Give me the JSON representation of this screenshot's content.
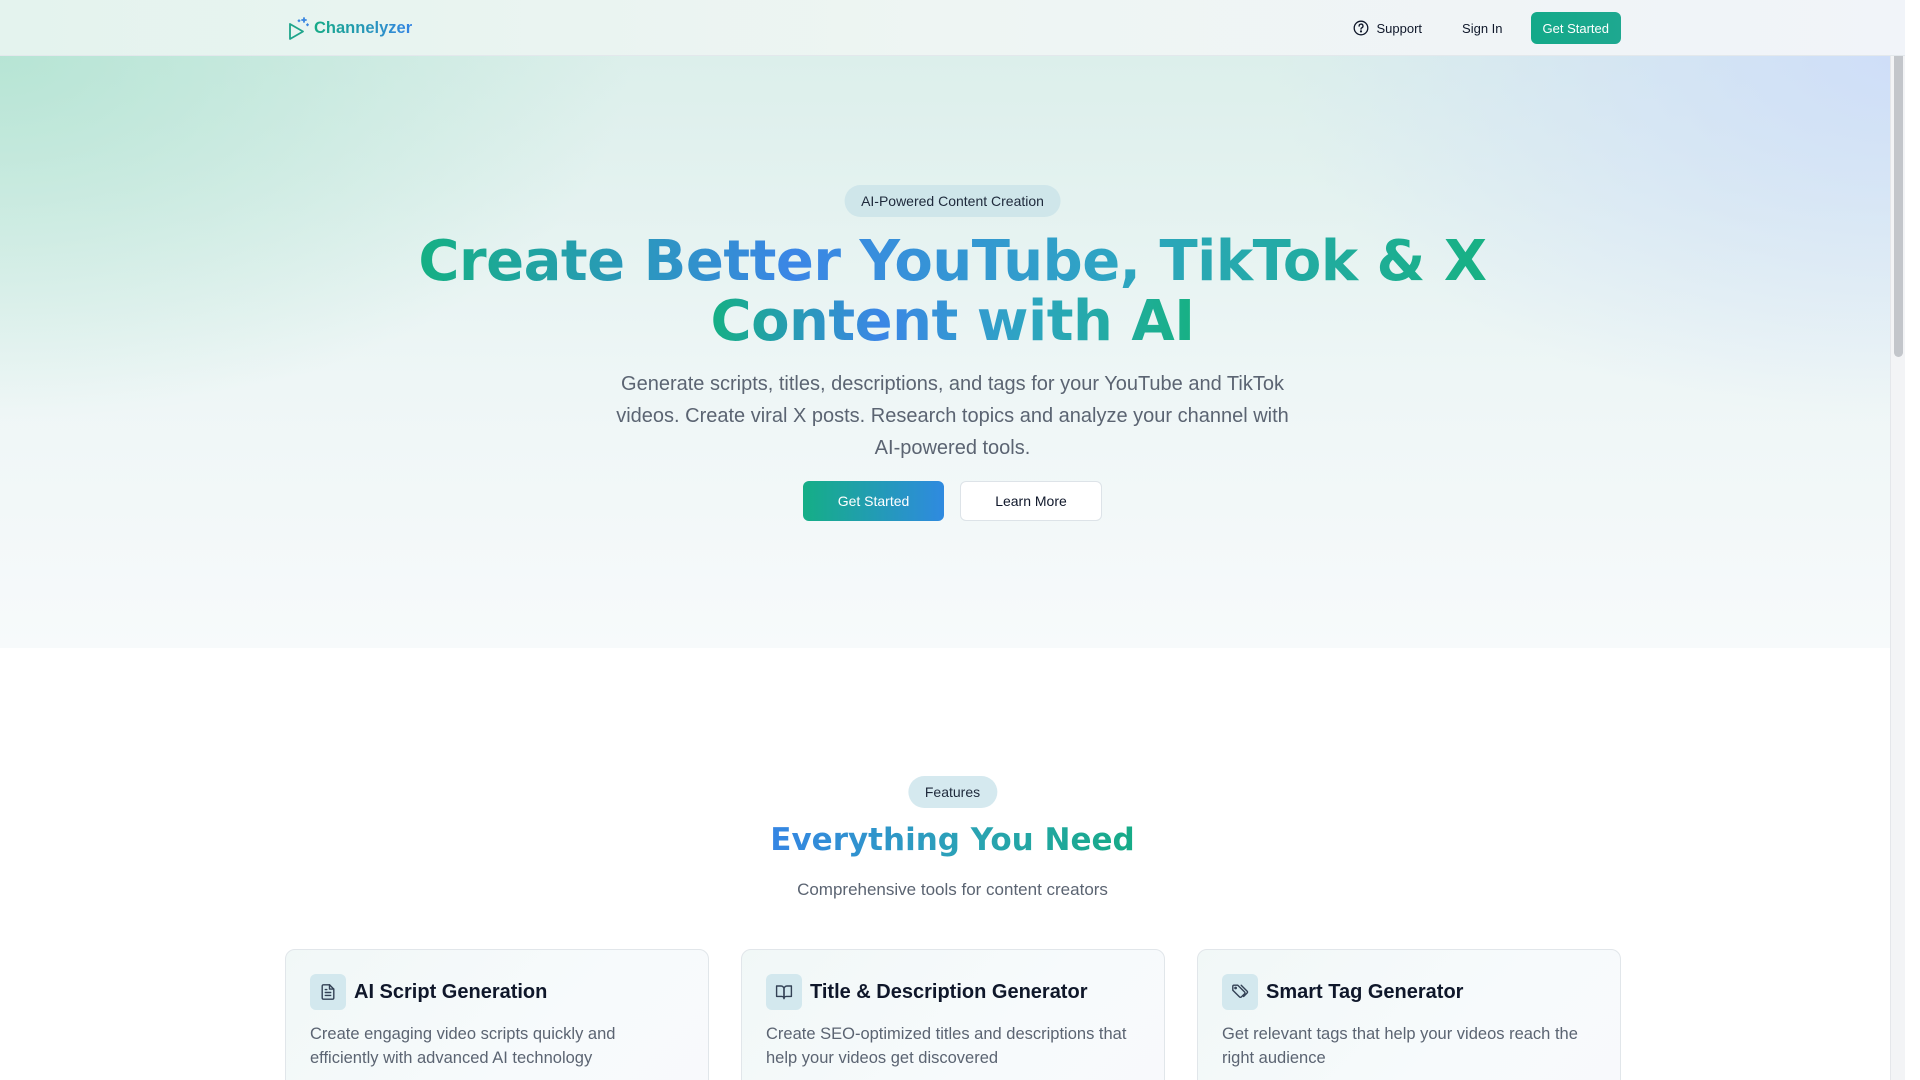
{
  "header": {
    "brand_name": "Channelyzer",
    "brand_icon": "send-sparkle-icon",
    "nav": {
      "support_label": "Support",
      "support_icon": "help-circle-icon",
      "signin_label": "Sign In",
      "cta_label": "Get Started"
    }
  },
  "hero": {
    "badge": "AI-Powered Content Creation",
    "title_line1": "Create Better YouTube, TikTok & X",
    "title_line2": "Content with AI",
    "subtitle": "Generate scripts, titles, descriptions, and tags for your YouTube and TikTok videos. Create viral X posts. Research topics and analyze your channel with AI-powered tools.",
    "primary_button": "Get Started",
    "secondary_button": "Learn More"
  },
  "features": {
    "badge": "Features",
    "title": "Everything You Need",
    "subtitle": "Comprehensive tools for content creators",
    "cards": [
      {
        "icon": "file-text-icon",
        "title": "AI Script Generation",
        "description": "Create engaging video scripts quickly and efficiently with advanced AI technology"
      },
      {
        "icon": "book-open-icon",
        "title": "Title & Description Generator",
        "description": "Create SEO-optimized titles and descriptions that help your videos get discovered"
      },
      {
        "icon": "tags-icon",
        "title": "Smart Tag Generator",
        "description": "Get relevant tags that help your videos reach the right audience"
      }
    ]
  },
  "colors": {
    "brand_green": "#16ab86",
    "brand_blue": "#3585e4",
    "text_muted": "#5b6472"
  }
}
